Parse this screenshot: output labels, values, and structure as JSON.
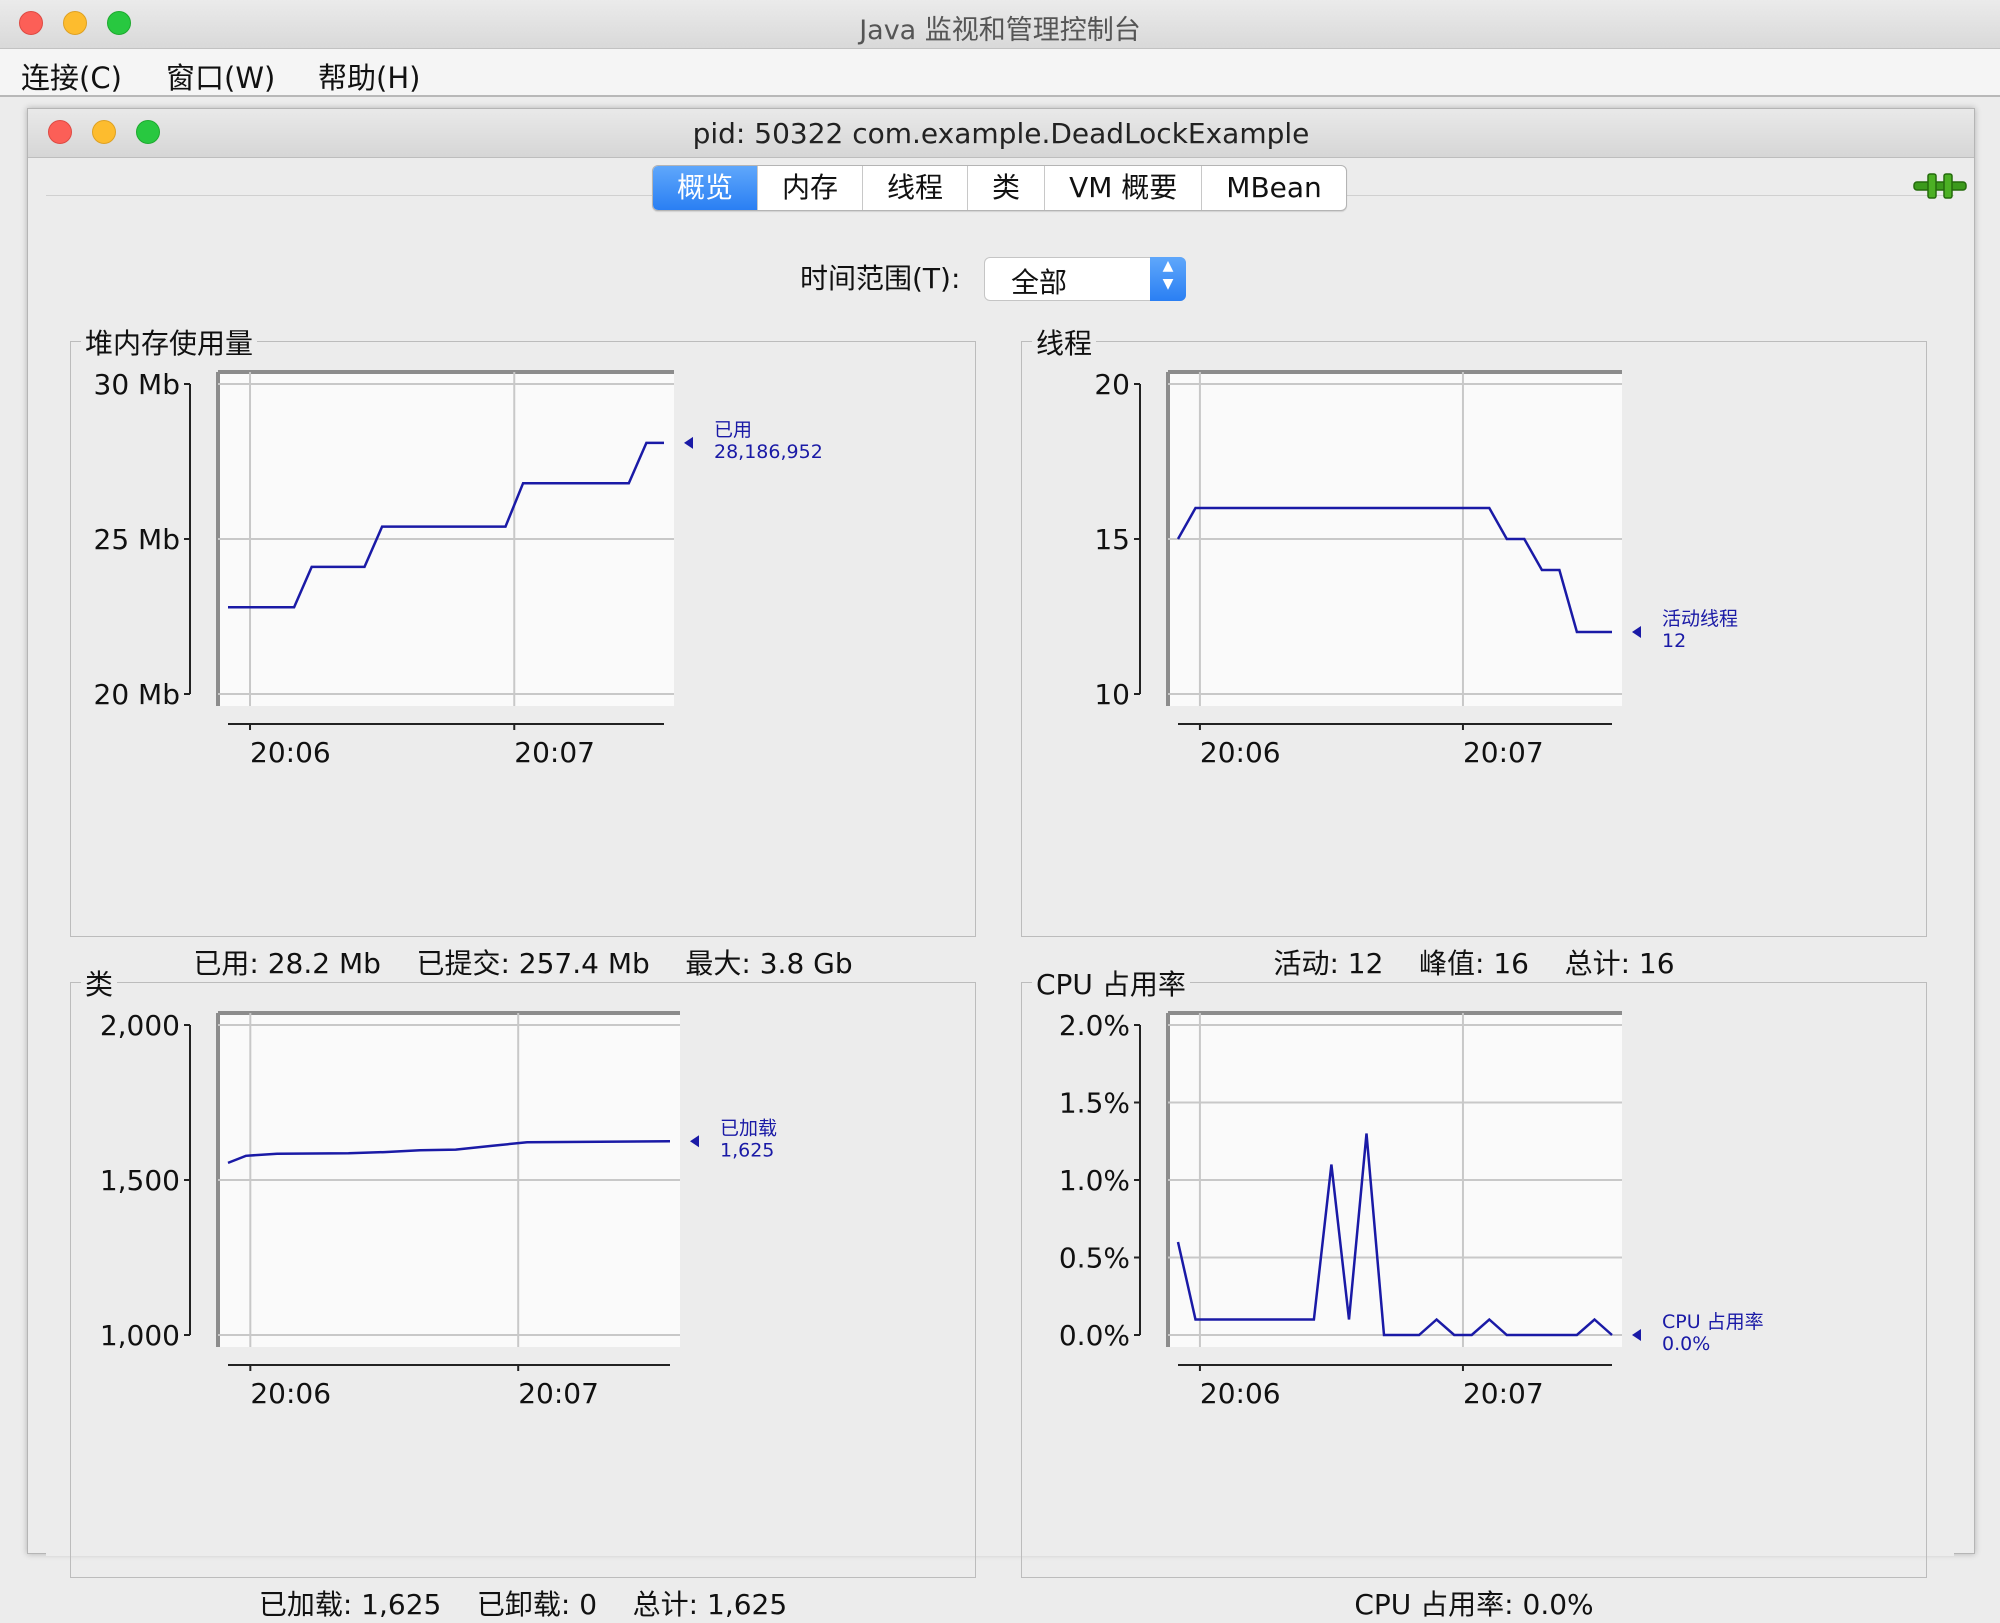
{
  "window": {
    "outer_title": "Java 监视和管理控制台",
    "inner_title": "pid: 50322 com.example.DeadLockExample"
  },
  "menu": {
    "items": [
      "连接(C)",
      "窗口(W)",
      "帮助(H)"
    ]
  },
  "tabs": {
    "items": [
      "概览",
      "内存",
      "线程",
      "类",
      "VM 概要",
      "MBean"
    ],
    "active": "概览"
  },
  "time_range": {
    "label": "时间范围(T):",
    "value": "全部"
  },
  "panels": {
    "heap": {
      "title": "堆内存使用量",
      "summary": "已用: 28.2 Mb    已提交: 257.4 Mb    最大: 3.8 Gb"
    },
    "threads": {
      "title": "线程",
      "summary": "活动: 12    峰值: 16    总计: 16"
    },
    "classes": {
      "title": "类",
      "summary": "已加载: 1,625    已卸载: 0    总计: 1,625"
    },
    "cpu": {
      "title": "CPU 占用率",
      "summary": "CPU 占用率: 0.0%"
    }
  },
  "colors": {
    "series": "#1a1aa6",
    "tab_active": "#2a7ff3",
    "grid": "#c8c8c8"
  },
  "chart_data": [
    {
      "id": "heap",
      "type": "line",
      "title": "堆内存使用量",
      "x_unit": "time",
      "xticks": [
        "20:06",
        "20:07"
      ],
      "y_ticks": [
        20,
        25,
        30
      ],
      "y_tick_labels": [
        "20 Mb",
        "25 Mb",
        "30 Mb"
      ],
      "ylim": [
        20,
        30
      ],
      "grid": true,
      "series": [
        {
          "name": "已用",
          "last_label": "28,186,952",
          "x": [
            "20:05:55",
            "20:06:10",
            "20:06:14",
            "20:06:26",
            "20:06:30",
            "20:06:58",
            "20:07:02",
            "20:07:26",
            "20:07:30",
            "20:07:34"
          ],
          "values": [
            22.8,
            22.8,
            24.1,
            24.1,
            25.4,
            25.4,
            26.8,
            26.8,
            28.1,
            28.1
          ]
        }
      ]
    },
    {
      "id": "threads",
      "type": "line",
      "title": "线程",
      "x_unit": "time",
      "xticks": [
        "20:06",
        "20:07"
      ],
      "y_ticks": [
        10,
        15,
        20
      ],
      "y_tick_labels": [
        "10",
        "15",
        "20"
      ],
      "ylim": [
        10,
        20
      ],
      "grid": true,
      "series": [
        {
          "name": "活动线程",
          "last_label": "12",
          "x": [
            "20:05:55",
            "20:05:59",
            "20:07:06",
            "20:07:10",
            "20:07:14",
            "20:07:18",
            "20:07:22",
            "20:07:26",
            "20:07:34"
          ],
          "values": [
            15,
            16,
            16,
            15,
            15,
            14,
            14,
            12,
            12
          ]
        }
      ]
    },
    {
      "id": "classes",
      "type": "line",
      "title": "类",
      "x_unit": "time",
      "xticks": [
        "20:06",
        "20:07"
      ],
      "y_ticks": [
        1000,
        1500,
        2000
      ],
      "y_tick_labels": [
        "1,000",
        "1,500",
        "2,000"
      ],
      "ylim": [
        1000,
        2000
      ],
      "grid": true,
      "series": [
        {
          "name": "已加载",
          "last_label": "1,625",
          "x": [
            "20:05:55",
            "20:05:59",
            "20:06:06",
            "20:06:22",
            "20:06:30",
            "20:06:38",
            "20:06:46",
            "20:06:54",
            "20:07:02",
            "20:07:34"
          ],
          "values": [
            1555,
            1578,
            1585,
            1586,
            1590,
            1596,
            1598,
            1610,
            1622,
            1625
          ]
        }
      ]
    },
    {
      "id": "cpu",
      "type": "line",
      "title": "CPU 占用率",
      "x_unit": "time",
      "xticks": [
        "20:06",
        "20:07"
      ],
      "y_ticks": [
        0,
        0.5,
        1.0,
        1.5,
        2.0
      ],
      "y_tick_labels": [
        "0.0%",
        "0.5%",
        "1.0%",
        "1.5%",
        "2.0%"
      ],
      "ylim": [
        0,
        2.0
      ],
      "grid": true,
      "series": [
        {
          "name": "CPU 占用率",
          "last_label": "0.0%",
          "x": [
            "20:05:55",
            "20:05:59",
            "20:06:26",
            "20:06:30",
            "20:06:34",
            "20:06:38",
            "20:06:42",
            "20:06:50",
            "20:06:54",
            "20:06:58",
            "20:07:02",
            "20:07:06",
            "20:07:10",
            "20:07:26",
            "20:07:30",
            "20:07:34"
          ],
          "values": [
            0.6,
            0.1,
            0.1,
            1.1,
            0.1,
            1.3,
            0.0,
            0.0,
            0.1,
            0.0,
            0.0,
            0.1,
            0.0,
            0.0,
            0.1,
            0.0
          ]
        }
      ]
    }
  ]
}
